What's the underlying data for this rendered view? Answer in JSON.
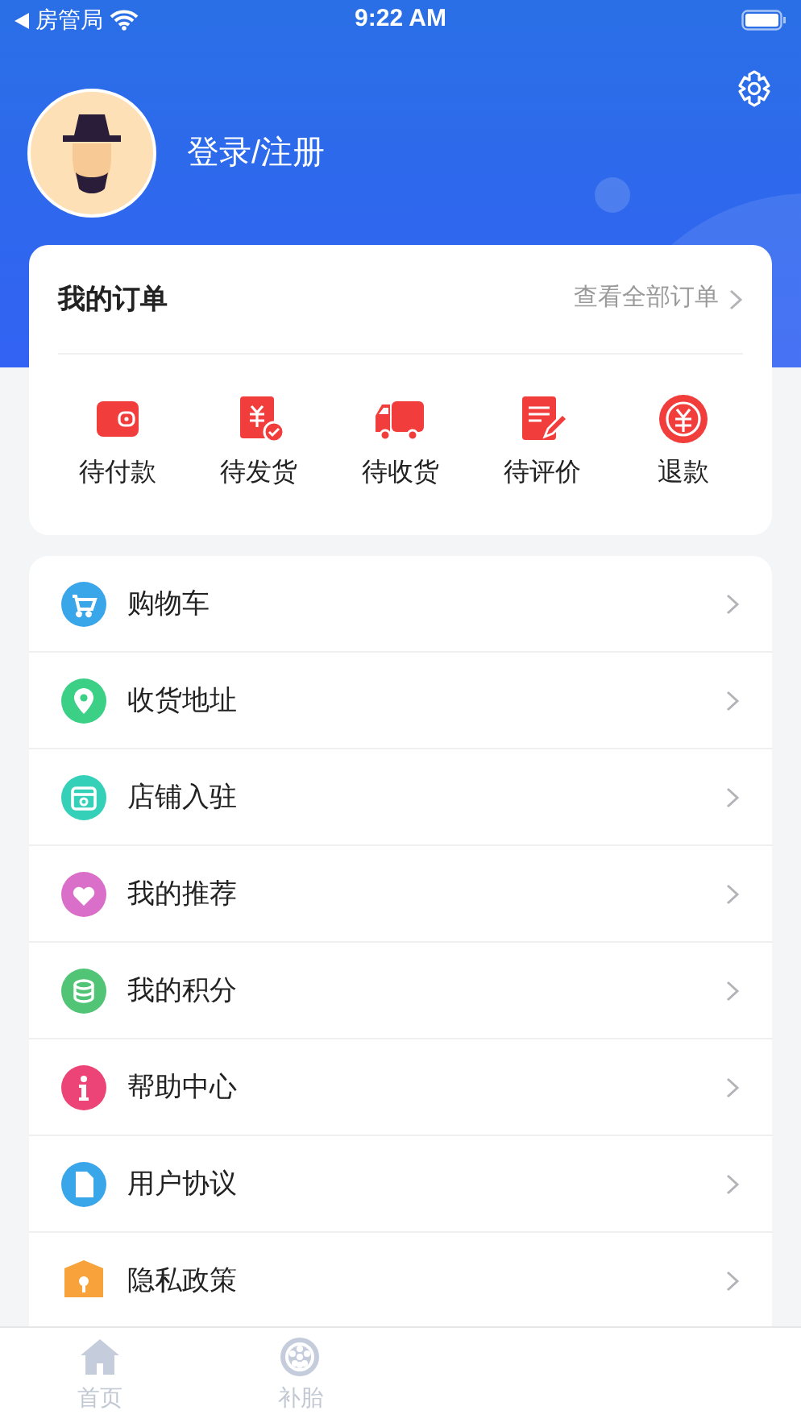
{
  "status_bar": {
    "carrier": "房管局",
    "time": "9:22 AM"
  },
  "profile": {
    "login_label": "登录/注册"
  },
  "orders": {
    "title": "我的订单",
    "view_all": "查看全部订单",
    "items": [
      {
        "label": "待付款"
      },
      {
        "label": "待发货"
      },
      {
        "label": "待收货"
      },
      {
        "label": "待评价"
      },
      {
        "label": "退款"
      }
    ]
  },
  "menu": [
    {
      "label": "购物车"
    },
    {
      "label": "收货地址"
    },
    {
      "label": "店铺入驻"
    },
    {
      "label": "我的推荐"
    },
    {
      "label": "我的积分"
    },
    {
      "label": "帮助中心"
    },
    {
      "label": "用户协议"
    },
    {
      "label": "隐私政策"
    }
  ],
  "tab_bar": [
    {
      "label": "首页",
      "selected": false
    },
    {
      "label": "补胎",
      "selected": false
    }
  ]
}
